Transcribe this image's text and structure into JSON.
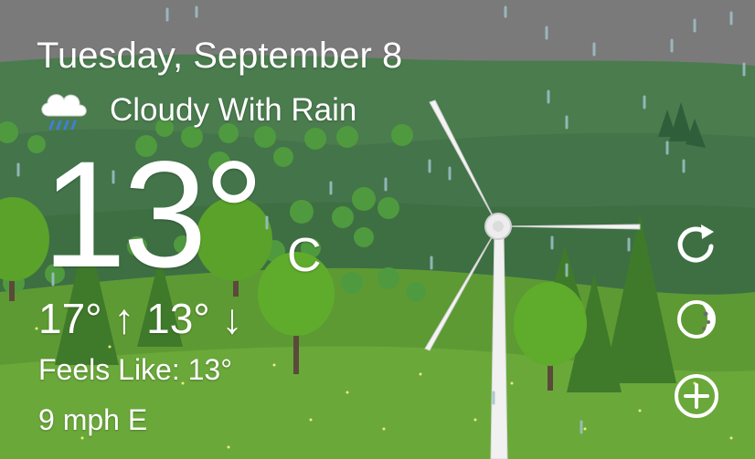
{
  "weather": {
    "date": "Tuesday, September 8",
    "condition": "Cloudy With Rain",
    "temperature": "13°",
    "unit": "C",
    "high_low": "17° ↑ 13° ↓",
    "feels_like": "Feels Like: 13°",
    "wind": "9 mph E"
  },
  "icons": {
    "condition": "cloud-rain-icon",
    "refresh": "refresh-icon",
    "moon_phase": "moon-icon",
    "add": "plus-circle-icon"
  },
  "colors": {
    "sky": "#7a7a7a",
    "far_hill": "#4a7c4e",
    "mid_hill": "#3d6f43",
    "meadow": "#5e9a34",
    "foreground": "#6aa83a",
    "tree": "#58a82a",
    "pine": "#3f7a2a",
    "text": "#ffffff",
    "rain": "#9fc1c8"
  }
}
